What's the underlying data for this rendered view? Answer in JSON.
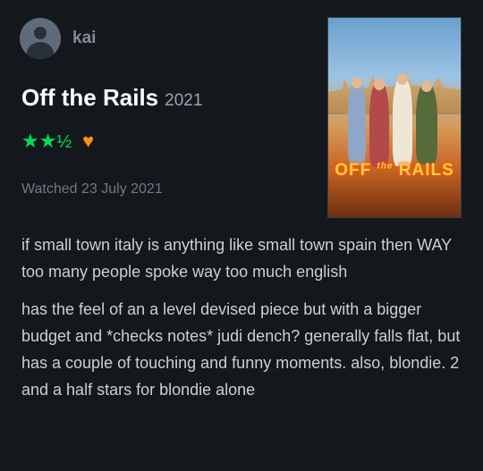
{
  "user": {
    "name": "kai"
  },
  "film": {
    "title": "Off the Rails",
    "year": "2021"
  },
  "rating": {
    "stars": "★★",
    "half": "½",
    "liked": true,
    "heart": "♥"
  },
  "watched": "Watched 23 July 2021",
  "poster": {
    "title_left": "OFF",
    "title_mid": "the",
    "title_right": "RAILS"
  },
  "review": {
    "paragraphs": [
      "if small town italy is anything like small town spain then WAY too many people spoke way too much english",
      "has the feel of an a level devised piece but with a bigger budget and *checks notes* judi dench? generally falls flat, but has a couple of touching and funny moments. also, blondie. 2 and a half stars for blondie alone"
    ]
  },
  "colors": {
    "background": "#14181c",
    "star_green": "#00e054",
    "heart_orange": "#ff9010"
  }
}
